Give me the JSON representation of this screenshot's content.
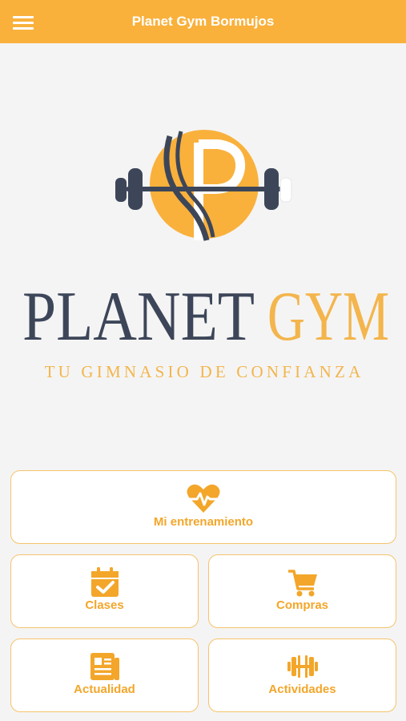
{
  "header": {
    "title": "Planet Gym Bormujos",
    "menu_icon": "hamburger-menu-icon"
  },
  "logo": {
    "brand_dark": "PLANET",
    "brand_accent": "GYM",
    "tagline": "TU GIMNASIO DE CONFIANZA",
    "mark_icon": "barbell-p-logo"
  },
  "menu": {
    "training": {
      "label": "Mi entrenamiento",
      "icon": "heartbeat-icon"
    },
    "classes": {
      "label": "Clases",
      "icon": "calendar-check-icon"
    },
    "shop": {
      "label": "Compras",
      "icon": "cart-icon"
    },
    "news": {
      "label": "Actualidad",
      "icon": "newspaper-icon"
    },
    "activities": {
      "label": "Actividades",
      "icon": "dumbbell-icon"
    }
  },
  "colors": {
    "accent": "#f9b13c",
    "dark": "#3d4659",
    "background": "#f4f4f4"
  }
}
